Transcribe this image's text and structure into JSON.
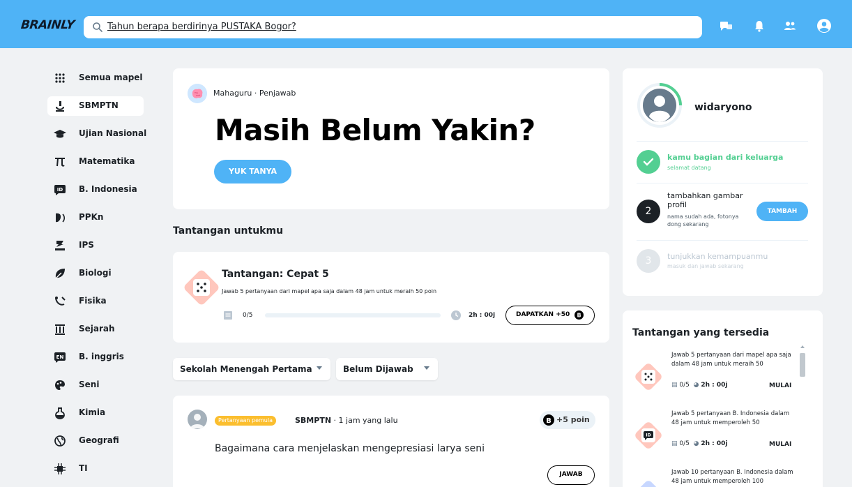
{
  "app": {
    "brand": "BRAINLY",
    "accent": "#4fb3f6",
    "success": "#53cf92",
    "dark": "#1c2126",
    "badge_color": "#fbbe2e",
    "hero_diamond_color": "#ffc7bd",
    "second_diamond_color": "#c7d7ff"
  },
  "search": {
    "value": "Tahun berapa berdirinya PUSTAKA Bogor?",
    "icon": "search-icon"
  },
  "header_icons": [
    "messages-icon",
    "bell-icon",
    "friends-icon",
    "profile-icon"
  ],
  "sidebar": {
    "items": [
      {
        "label": "Semua mapel",
        "icon": "grid-icon"
      },
      {
        "label": "SBMPTN",
        "icon": "microscope-icon",
        "active": true
      },
      {
        "label": "Ujian Nasional",
        "icon": "graduation-cap-icon"
      },
      {
        "label": "Matematika",
        "icon": "pi-icon"
      },
      {
        "label": "B. Indonesia",
        "icon": "id-badge-icon"
      },
      {
        "label": "PPKn",
        "icon": "ppkn-icon"
      },
      {
        "label": "IPS",
        "icon": "ips-icon"
      },
      {
        "label": "Biologi",
        "icon": "leaf-icon"
      },
      {
        "label": "Fisika",
        "icon": "physics-icon"
      },
      {
        "label": "Sejarah",
        "icon": "building-icon"
      },
      {
        "label": "B. inggris",
        "icon": "en-badge-icon"
      },
      {
        "label": "Seni",
        "icon": "palette-icon"
      },
      {
        "label": "Kimia",
        "icon": "flask-icon"
      },
      {
        "label": "Geografi",
        "icon": "globe-icon"
      },
      {
        "label": "TI",
        "icon": "chip-icon"
      }
    ]
  },
  "hero": {
    "rank": "Mahaguru · Penjawab",
    "headline": "Masih Belum Yakin?",
    "cta": "YUK TANYA"
  },
  "challenges_section": {
    "title": "Tantangan untukmu",
    "challenge": {
      "title": "Tantangan: Cepat 5",
      "description": "Jawab 5 pertanyaan dari mapel apa saja dalam 48 jam untuk meraih 50 poin",
      "progress_text": "0/5",
      "progress_fraction": 0,
      "timer": "2h : 00j",
      "reward_button": "DAPATKAN +50"
    }
  },
  "filters": {
    "level": "Sekolah Menengah Pertama",
    "status": "Belum Dijawab"
  },
  "question": {
    "badge": "Pertanyaan pemula",
    "subject": "SBMPTN",
    "time": "1 jam yang lalu",
    "points": "+5 poin",
    "text": "Bagaimana cara menjelaskan mengepresiasi larya seni",
    "answer_button": "JAWAB"
  },
  "profile": {
    "username": "widaryono",
    "steps": [
      {
        "number": "",
        "title": "kamu bagian dari keluarga",
        "subtitle": "selamat datang",
        "state": "done"
      },
      {
        "number": "2",
        "title": "tambahkan gambar profil",
        "subtitle": "nama sudah ada, fotonya dong sekarang",
        "state": "current",
        "action": "TAMBAH"
      },
      {
        "number": "3",
        "title": "tunjukkan kemampuanmu",
        "subtitle": "masuk dan jawab sekarang",
        "state": "locked"
      }
    ]
  },
  "available_challenges": {
    "title": "Tantangan yang tersedia",
    "items": [
      {
        "description": "Jawab 5 pertanyaan dari mapel apa saja dalam 48 jam untuk meraih 50",
        "progress": "0/5",
        "timer": "2h : 00j",
        "action": "MULAI",
        "icon": "dice-icon"
      },
      {
        "description": "Jawab 5 pertanyaan B. Indonesia dalam 48 jam untuk memperoleh 50",
        "progress": "0/5",
        "timer": "2h : 00j",
        "action": "MULAI",
        "icon": "id-badge-icon"
      },
      {
        "description": "Jawab 10 pertanyaan B. Indonesia dalam 48 jam untuk memperoleh 100",
        "progress": "",
        "timer": "",
        "action": "",
        "icon": "id-badge-icon"
      }
    ]
  }
}
